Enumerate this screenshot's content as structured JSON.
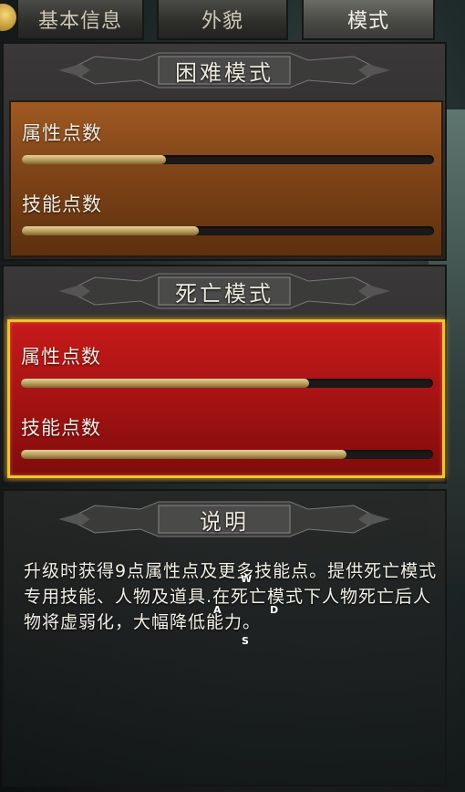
{
  "tabs": [
    {
      "label": "基本信息",
      "active": false
    },
    {
      "label": "外貌",
      "active": false
    },
    {
      "label": "模式",
      "active": true
    }
  ],
  "hard_mode": {
    "title": "困难模式",
    "rows": [
      {
        "label": "属性点数",
        "progress": 0.35
      },
      {
        "label": "技能点数",
        "progress": 0.43
      }
    ]
  },
  "death_mode": {
    "title": "死亡模式",
    "selected": true,
    "rows": [
      {
        "label": "属性点数",
        "progress": 0.7
      },
      {
        "label": "技能点数",
        "progress": 0.79
      }
    ]
  },
  "description": {
    "title": "说明",
    "text": "升级时获得9点属性点及更多技能点。提供死亡模式专用技能、人物及道具.在死亡模式下人物死亡后人物将虚弱化，大幅降低能力。"
  },
  "key_hints": {
    "w": "W",
    "a": "A",
    "s": "S",
    "d": "D"
  },
  "colors": {
    "hard_panel": "#8a4a1b",
    "death_panel": "#b01616",
    "selection_border": "#f0c336",
    "bar_fill": "#c8ad6e"
  }
}
